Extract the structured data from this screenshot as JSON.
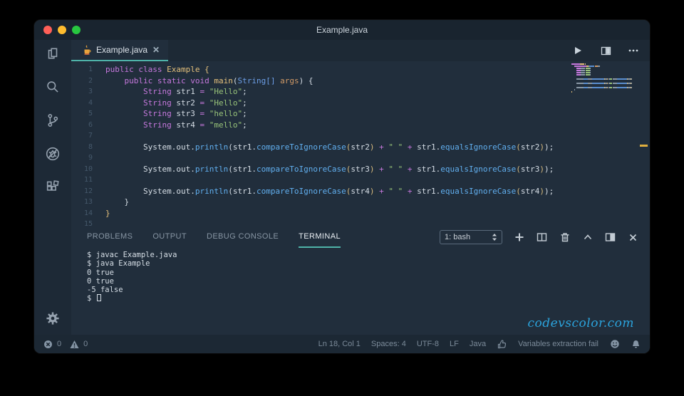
{
  "window": {
    "title": "Example.java"
  },
  "tab": {
    "label": "Example.java",
    "close_glyph": "✕"
  },
  "icons": {
    "activity_bar": [
      "explorer-icon",
      "search-icon",
      "source-control-icon",
      "debug-icon",
      "extensions-icon",
      "gear-icon"
    ],
    "editor_actions": [
      "run-icon",
      "split-editor-icon",
      "more-actions-icon"
    ],
    "panel_controls": [
      "new-terminal-icon",
      "split-terminal-icon",
      "trash-icon",
      "chevron-up-icon",
      "maximize-panel-icon",
      "close-panel-icon"
    ],
    "status": [
      "error-icon",
      "warning-icon",
      "thumbs-up-icon",
      "smiley-icon",
      "bell-icon"
    ]
  },
  "colors": {
    "accent_teal": "#4fb3a9",
    "keyword": "#c678dd",
    "classname": "#e5c07b",
    "method": "#61afef",
    "string": "#98c379",
    "argument": "#d19a66",
    "watermark_blue": "#2ba3dc",
    "ruler_marker": "#e0af3f",
    "traffic_red": "#ff5f57",
    "traffic_yellow": "#febc2e",
    "traffic_green": "#28c840"
  },
  "editor": {
    "lines": [
      {
        "num": "1",
        "tokens": [
          [
            "kw",
            "public class "
          ],
          [
            "cls",
            "Example"
          ],
          [
            "pl",
            " "
          ],
          [
            "brk",
            "{"
          ]
        ]
      },
      {
        "num": "2",
        "tokens": [
          [
            "pl",
            "    "
          ],
          [
            "kw",
            "public static void "
          ],
          [
            "cls",
            "main"
          ],
          [
            "pl",
            "("
          ],
          [
            "typ",
            "String[]"
          ],
          [
            "pl",
            " "
          ],
          [
            "arg",
            "args"
          ],
          [
            "pl",
            ") {"
          ]
        ]
      },
      {
        "num": "3",
        "tokens": [
          [
            "pl",
            "        "
          ],
          [
            "kw",
            "String"
          ],
          [
            "pl",
            " str1 "
          ],
          [
            "op",
            "="
          ],
          [
            "pl",
            " "
          ],
          [
            "str",
            "\"Hello\""
          ],
          [
            "pl",
            ";"
          ]
        ]
      },
      {
        "num": "4",
        "tokens": [
          [
            "pl",
            "        "
          ],
          [
            "kw",
            "String"
          ],
          [
            "pl",
            " str2 "
          ],
          [
            "op",
            "="
          ],
          [
            "pl",
            " "
          ],
          [
            "str",
            "\"Hello\""
          ],
          [
            "pl",
            ";"
          ]
        ]
      },
      {
        "num": "5",
        "tokens": [
          [
            "pl",
            "        "
          ],
          [
            "kw",
            "String"
          ],
          [
            "pl",
            " str3 "
          ],
          [
            "op",
            "="
          ],
          [
            "pl",
            " "
          ],
          [
            "str",
            "\"hello\""
          ],
          [
            "pl",
            ";"
          ]
        ]
      },
      {
        "num": "6",
        "tokens": [
          [
            "pl",
            "        "
          ],
          [
            "kw",
            "String"
          ],
          [
            "pl",
            " str4 "
          ],
          [
            "op",
            "="
          ],
          [
            "pl",
            " "
          ],
          [
            "str",
            "\"mello\""
          ],
          [
            "pl",
            ";"
          ]
        ]
      },
      {
        "num": "7",
        "tokens": []
      },
      {
        "num": "8",
        "tokens": [
          [
            "pl",
            "        System.out."
          ],
          [
            "fn",
            "println"
          ],
          [
            "pl",
            "("
          ],
          [
            "pl",
            "str1."
          ],
          [
            "fn",
            "compareToIgnoreCase"
          ],
          [
            "pn",
            "("
          ],
          [
            "pl",
            "str2"
          ],
          [
            "pn",
            ")"
          ],
          [
            "op",
            " + "
          ],
          [
            "str",
            "\" \""
          ],
          [
            "op",
            " + "
          ],
          [
            "pl",
            "str1."
          ],
          [
            "fn",
            "equalsIgnoreCase"
          ],
          [
            "pn",
            "("
          ],
          [
            "pl",
            "str2"
          ],
          [
            "pn",
            ")"
          ],
          [
            "pl",
            ");"
          ]
        ]
      },
      {
        "num": "9",
        "tokens": []
      },
      {
        "num": "10",
        "tokens": [
          [
            "pl",
            "        System.out."
          ],
          [
            "fn",
            "println"
          ],
          [
            "pl",
            "("
          ],
          [
            "pl",
            "str1."
          ],
          [
            "fn",
            "compareToIgnoreCase"
          ],
          [
            "pn",
            "("
          ],
          [
            "pl",
            "str3"
          ],
          [
            "pn",
            ")"
          ],
          [
            "op",
            " + "
          ],
          [
            "str",
            "\" \""
          ],
          [
            "op",
            " + "
          ],
          [
            "pl",
            "str1."
          ],
          [
            "fn",
            "equalsIgnoreCase"
          ],
          [
            "pn",
            "("
          ],
          [
            "pl",
            "str3"
          ],
          [
            "pn",
            ")"
          ],
          [
            "pl",
            ");"
          ]
        ]
      },
      {
        "num": "11",
        "tokens": []
      },
      {
        "num": "12",
        "tokens": [
          [
            "pl",
            "        System.out."
          ],
          [
            "fn",
            "println"
          ],
          [
            "pl",
            "("
          ],
          [
            "pl",
            "str1."
          ],
          [
            "fn",
            "compareToIgnoreCase"
          ],
          [
            "pn",
            "("
          ],
          [
            "pl",
            "str4"
          ],
          [
            "pn",
            ")"
          ],
          [
            "op",
            " + "
          ],
          [
            "str",
            "\" \""
          ],
          [
            "op",
            " + "
          ],
          [
            "pl",
            "str1."
          ],
          [
            "fn",
            "equalsIgnoreCase"
          ],
          [
            "pn",
            "("
          ],
          [
            "pl",
            "str4"
          ],
          [
            "pn",
            ")"
          ],
          [
            "pl",
            ");"
          ]
        ]
      },
      {
        "num": "13",
        "tokens": [
          [
            "pl",
            "    }"
          ]
        ]
      },
      {
        "num": "14",
        "tokens": [
          [
            "brk",
            "}"
          ]
        ]
      },
      {
        "num": "15",
        "tokens": []
      }
    ]
  },
  "panel": {
    "tabs": [
      {
        "label": "PROBLEMS",
        "active": false
      },
      {
        "label": "OUTPUT",
        "active": false
      },
      {
        "label": "DEBUG CONSOLE",
        "active": false
      },
      {
        "label": "TERMINAL",
        "active": true
      }
    ],
    "shell_select": "1: bash",
    "terminal_lines": [
      {
        "text": "$ javac Example.java"
      },
      {
        "text": "$ java Example"
      },
      {
        "text": "0 true"
      },
      {
        "text": "0 true"
      },
      {
        "text": "-5 false"
      },
      {
        "text": "$ ",
        "cursor": true
      }
    ],
    "watermark": "codevscolor.com"
  },
  "status": {
    "errors": "0",
    "warnings": "0",
    "items": [
      "Ln 18, Col 1",
      "Spaces: 4",
      "UTF-8",
      "LF",
      "Java"
    ],
    "message": "Variables extraction fail"
  }
}
